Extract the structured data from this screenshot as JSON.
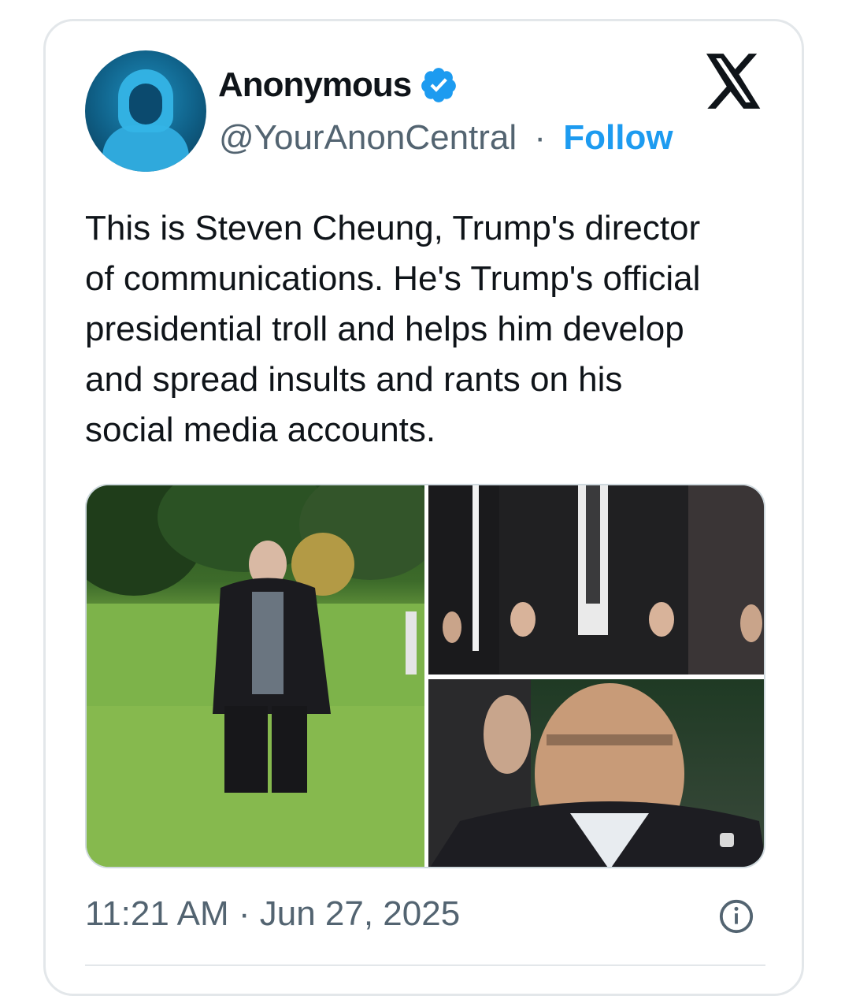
{
  "author": {
    "display_name": "Anonymous",
    "handle": "@YourAnonCentral",
    "separator": "·",
    "follow_label": "Follow"
  },
  "platform_icon": "x-logo-icon",
  "tweet": {
    "lines": [
      "This is Steven Cheung, Trump's director",
      "of communications. He's Trump's official",
      "presidential troll and helps him develop",
      "and spread insults and rants on his",
      "social media accounts."
    ]
  },
  "media": {
    "count": 3
  },
  "footer": {
    "timestamp": "11:21 AM · Jun 27, 2025",
    "info_icon": "info-icon"
  },
  "colors": {
    "accent": "#1d9bf0",
    "secondary_text": "#536471",
    "primary_text": "#0f1419",
    "border": "#e3e7ea"
  }
}
